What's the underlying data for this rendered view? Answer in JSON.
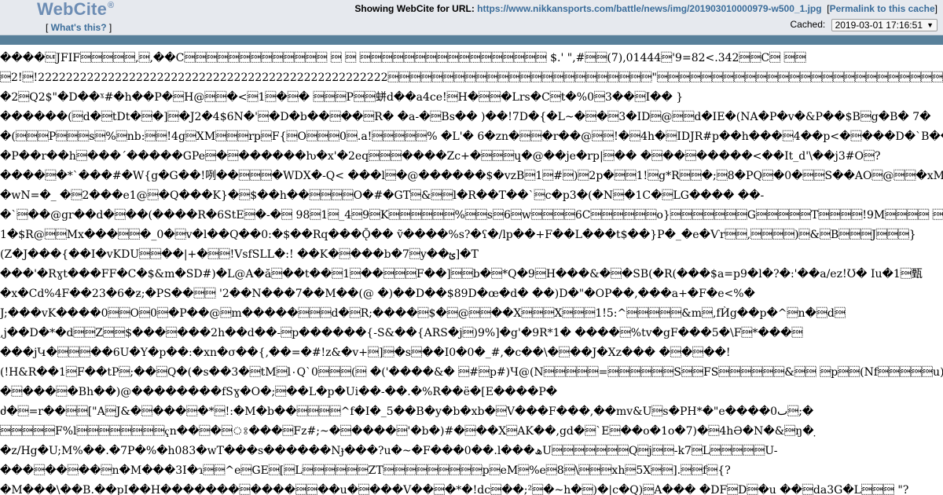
{
  "header": {
    "logo": "WebCite",
    "logo_mark": "®",
    "whats_this_open": "[ ",
    "whats_this_label": "What's this?",
    "whats_this_close": " ]",
    "showing_label": "Showing WebCite for URL:",
    "url": "https://www.nikkansports.com/battle/news/img/201903010000979-w500_1.jpg",
    "permalink_open": "[",
    "permalink_label": "Permalink to this cache",
    "permalink_close": "]",
    "cached_label": "Cached:",
    "cached_value": "2019-03-01 17:16:51",
    "cached_arrow": "▼"
  },
  "colors": {
    "header_bg": "#e6e9ee",
    "logo": "#6d8db4",
    "link": "#3b6d9a",
    "bar": "#58809a"
  },
  "content_lines": [
    "����\u0010JFIF\u0001\u0001\u0001\u0001\u0001,\u0001,��C\u0001\u0001\u0001\u0001\u0001\u0001\u0001\u0001\u0001\u0001\u0001\u0001\u0001 \u0001 \u0001 \u0001\u0001\u0001\u0001\u0001\u0001\u0001\u0001\u0001\u0001\u0001\u0001\u0001\u0001\u0001\u0001\u0001 $.' \",#\u0001\u0001(7),01444\u0001'9=82<.342\u0001\u0001C\u0001 \u0001\u0001",
    "\u00012!\u0001!22222222222222222222222222222222222222222222222222\u0001\u0001\u0001\u0001\u0001\u0001\u0001\u0001\u0001\u0001\u0001\u0001\u0001\u0001\u0001\u0001\u0001\u0001\u0001\u0001\u0001\u0001\u0001\u0001\"\u0001\u0001\u0001\u0001\u0001\u0001\u0001\u0001\u0001\u0001\u0001\u0001\u0001\u0001\u0001\u0001\u0001\u0001\u0001\u0001\u0001\u0001\u0001\u0001\u0001\u0001\u0001\u0001\u0001\u0001\u0001\u0001\u0001\u0001\u0001\u0001\u0001\u0001D\u0001\u0001\u0001\u0001\u0001\u0001\u0001\u0001\u0001\u0001\u0001\u0001\u0001\u0001\u0001\u0001\u0001\u0001\u0001\u0001\u0001\u0001\u0001\u0001\u0001\u0001\u0001\u0001\u0001!\u00011\u0001\u0001AQa",
    "�2\u0001Q2$\"�D��ˠ#�h��P�\u0001H@\u0001\u0001�<\u00011\u0001�\u0001� \u0001\u0001\u0001P\u0001\u0001蛢d��a4ce!\u0001H�\u0001\u0001�Lrs�C\u0001t�%0\u00013��\u0001I�� }",
    "������(\u0001d�\u0001tDt�\u0001�]\u0001�J2�4$6N�'\u0001�D�b��\u0001��\u0001R� �a-�\u0001Bs�� )��!7D�{�L~�\u0001�\u00013�ID\u0001@\u0001\u0001d�IE�(NA�P�v�&P��$B\u0001g�B� 7�",
    "�(\u0001\u0001\u0001P\u0001\u0001\u0001s\u0001%\u0001nb:\u0001\u0001!4g\u0001XM\u0001\u0001\u0001rp\u0001F{\u0001O\u0001\u0001\u00010\u0001.a!\u0001\u0001\u0001\u0001\u0001% �L'� 6�zn�\u0001\u0001�r��@\u0001\u0001!�\u00014h�\u0001IDJR#p��h���\u00014��p<�\u0001���D�`B��/",
    "�P��r��h\u0001���´�����GPe\u0001�\u0001������ƕ�x'�2eq\u0001\u0001\u0001����Zc+�\u0001\u0001\u0001ɥ�@��je�rp|\u0001�� �\u0001��\u0001�����<��It_d'\\��j3#O\u0001?",
    "����\u0001�*`���#�W{g�G��!咧��\u0001\u0001\u0001�WDX�-Q< ���l\u0001�@������$�vzB\u00011\u0001#\u0001)\u00012p�\u0001\u00011!\u0001g*R\u0001\u0001�;\u00018�PQ\u0001�0�\u0001\u0001S��AO\u0001@\u0001\u0001�xM(\u0001&",
    "�wN=�_ �\u00012���e1@\u0001�Q���K}�\u0001$��h��\u0001\u0001\u0001\u0001O�#�GT\u0001&\u0001\u0001l�R��T��`\u0001c�p3�(�N\u0001�1C�\u0001LG���� ��-",
    "�`\u0001��@gr��d�\u0001��(����R�6StE\u0001�-�\u0001 98\u00011\u0001_4\u00019\u0001K\u0001\u0001\u0001\u0001\u0001\u0001%\u0001\u0001s\u00016\u0001w\u0001\u0001\u0001\u00016C\u0001\u0001\u0001\u0001\u0001\u0001o}\u0001\u0001\u0001\u0001\u0001\u0001\u0001G\u0001\u0001\u0001\u0001\u0001T\u0001\u0001\u0001\u0001!9M\u0001\u0001\u0001\u0001 \u0001悗",
    "1�$R@\u0001\u0001Mx���\u0001\u0001�_0�\u0001v�l��Q��0:�$��Rq���Ǭ�� ṽ����%s?�ʕ�/lp��+F��L���t$��}P�_�e�Ѵr\u0001\u0001,\u0001\u0001\u0001\u0001)\u0001&\u0001B\u0001\u0001\u0001J\u0001\u0001\u0001}",
    "(Z�J���{��I�vKDU\u0001\u0001��|+�\u0001\u0001!VsfSLL�:! ��K�\u0001���b�7\u0001y��ؿ]�T",
    "���'�Rɣt���FF�C�$&m�SD#)�L@A�ă\u0001��t��\u00011\u0001��\u0001\u0001\u0001F��]\u0001\u0001b�\u0001*Q�9\u0001H���&�\u0001�SB(�R(���$a=p9�l�?�:'��a/ez!Ʊ� Iu�1\u0001甄",
    "�x�Cd%4F��23�6�ƶ;�PS��\u0001\u0001 '2��N���7��M��(@ �)��D��$89D�œ�d� ��)D�\"�OP��,���a+�F�e<%�",
    "J;���vK����0\u0001\u0001O\u00010\u0001�P��@\u0001m�����\u0001\u0001\u0001d�\u0001R;����\u0001$�\u0001@\u0001\u0001��X\u0001\u0001\u0001X\u0001\u0001\u00011!5:^\u0001\u0001\u0001\u0001\u0001&m\u0001,fЍg��p�^\u0001n�\u0001d\u0001",
    "‚j��D�*�d\u0001\u0001Z\u0001\u0001$���\u0001���2h��d��-\u0001p������{-S&��{ARS�j\u0001)9%]�g'�9R*1� ����\u0001%tv�gF���5�\\F\u0001*���\u0001",
    "���jԿ�\u0001\u0001\u0001��6U�Y�p��:�xn�σ��{,��=�#!z&�v+\u0001]\u0001�s\u0001��I0�0�_#,�c��\\�\u0001��J�Xz��� �\u0001�\u0001��!",
    "(!H&R��1\u0001F��tP\u0001;��\u0001Q�(�s��3�\u0001tM\u0001l۰Q`0\u0001\u0001\u0001(\u0001 �('����&� \u0001#\u0001p#)Ч@(N\u0001\u0001\u0001\u0001\u0001=\u0001\u0001\u0001\u0001\u0001\u0001S\u0001\u0001FS\u0001\u0001\u0001\u0001\u0001\u0001&\u0001\u0001 \u0001p\u0001\u0001(Nf\u0001\u0001\u0001\u0001\u0001u)\u0001\u0001]|",
    "�\u0001���\u0001�Bh��)@��������fSɣ�O�;\u0001��L�p�Ui��-��.�%R��ë�[E����P�",
    "ძ�\u0001=r��\u0001\u0001[\"A\u0001J&�\u0001���\u0001�*\u0001!:�M�b��\u0001\u0001\u0001\u0001^f�I�_5��B�y�b�xb�\u0001V���F���,��mv&U\u0001s�PH*�\"e����0ٮ\u0001;�",
    "\u0001\u0001\u0001\u0001\u0001F%l\u0001\u0001\u0001\u0001\u0001\u0001\u0001\u0001ҁn��\u0001�\u0001ঃ���\u0001Fz#;~�\u0001����\u0001'�b�)#�\u0001��X\u0001AK��,gd�\u0001`E\u0001��o�1o�7)�\u00014hƏ�N�&\u0001ŋ� ̣",
    "�z/Hg�U;M%��.�7P�%�h083�wT���s������Nɟ���?u�~�F���0��.l���ﮪU\u0001\u0001\u0001\u0001\u0001\u0001\u0001Q\u0001j\u0001\u0001-k7\u0001L\u0001\u0001\u0001\u0001\u0001U-",
    "���\u0001��\u0001��\u0001n�M���3I�ɿ\u0001\u0001^e\u0001GE\u0001[\u0001L\u0001\u0001\u0001\u0001\u0001\u0001ZT\u0001\u0001\u0001\u0001\u0001\u0001\u0001\u0001\u0001p\u0001eM\u0001%e\u00018\u0001\\\u0001\u0001\u0001xh\u00015X\u0001\u0001].\u0001\u0001f\u0001{?",
    "�M���\\��B.��pI��H�������\u0001����\u0001\u0001��u�\u0001���V��\u0001�*�!dc\u0001��;²\u0001�~h�\u0001)�|c�Q)\u0001A��� �DF\u0001D\u0001�u ��\u0001da3G�L\u0001\u0001\u0001 \"?"
  ]
}
